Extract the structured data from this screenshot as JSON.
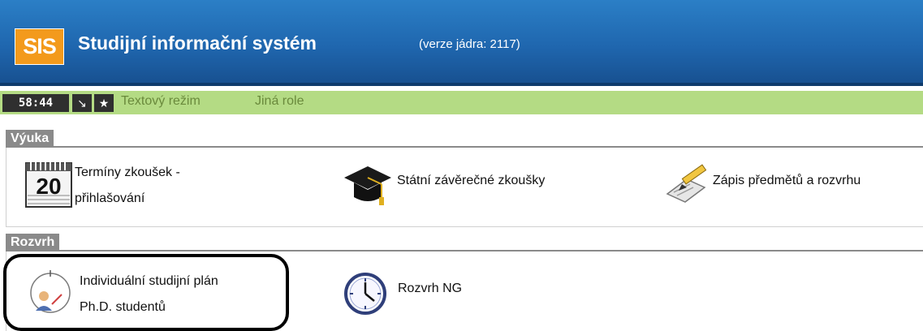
{
  "header": {
    "logo_text": "SIS",
    "title": "Studijní informační systém",
    "version": "(verze jádra: 2117)"
  },
  "toolbar": {
    "timer": "58:44",
    "links": [
      "Textový režim",
      "Jiná role"
    ]
  },
  "sections": {
    "vyuka": {
      "label": "Výuka",
      "items": [
        {
          "line1": "Termíny zkoušek -",
          "line2": "přihlašování",
          "icon": "calendar-20-icon"
        },
        {
          "line1": "Státní závěrečné zkoušky",
          "icon": "graduation-cap-icon"
        },
        {
          "line1": "Zápis předmětů a rozvrhu",
          "icon": "pencil-clipboard-icon"
        }
      ]
    },
    "rozvrh": {
      "label": "Rozvrh",
      "items": [
        {
          "line1": "Individuální studijní plán",
          "line2": "Ph.D. studentů",
          "icon": "study-plan-icon"
        },
        {
          "line1": "Rozvrh NG",
          "icon": "clock-icon"
        }
      ]
    }
  },
  "colors": {
    "header_blue": "#1f66ae",
    "logo_orange": "#f39a1c",
    "toolbar_green": "#b4db84",
    "section_gray": "#8a8a8a"
  }
}
